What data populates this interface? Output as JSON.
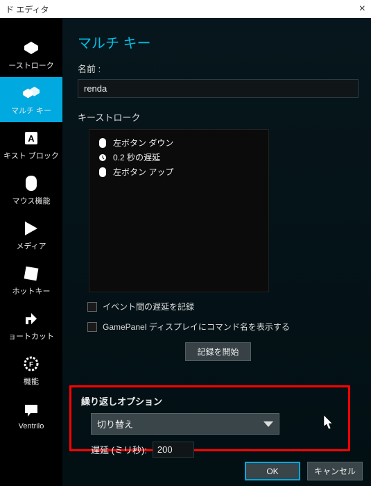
{
  "title": "ド エディタ",
  "sidebar": {
    "items": [
      {
        "label": "ーストローク"
      },
      {
        "label": "マルチ キー"
      },
      {
        "label": "キスト ブロック"
      },
      {
        "label": "マウス機能"
      },
      {
        "label": "メディア"
      },
      {
        "label": "ホットキー"
      },
      {
        "label": "ョートカット"
      },
      {
        "label": "機能"
      },
      {
        "label": "Ventrilo"
      }
    ]
  },
  "panel": {
    "heading": "マルチ キー",
    "name_label": "名前 :",
    "name_value": "renda",
    "keystroke_label": "キーストローク",
    "keystrokes": [
      {
        "icon": "mouse",
        "text": "左ボタン ダウン"
      },
      {
        "icon": "clock",
        "text": "0.2 秒の遅延"
      },
      {
        "icon": "mouse",
        "text": "左ボタン アップ"
      }
    ],
    "check1": "イベント間の遅延を記録",
    "check2": "GamePanel ディスプレイにコマンド名を表示する",
    "record_btn": "記録を開始"
  },
  "repeat": {
    "title": "繰り返しオプション",
    "mode": "切り替え",
    "delay_label": "遅延 (ミリ秒):",
    "delay_value": "200"
  },
  "footer": {
    "ok": "OK",
    "cancel": "キャンセル"
  }
}
